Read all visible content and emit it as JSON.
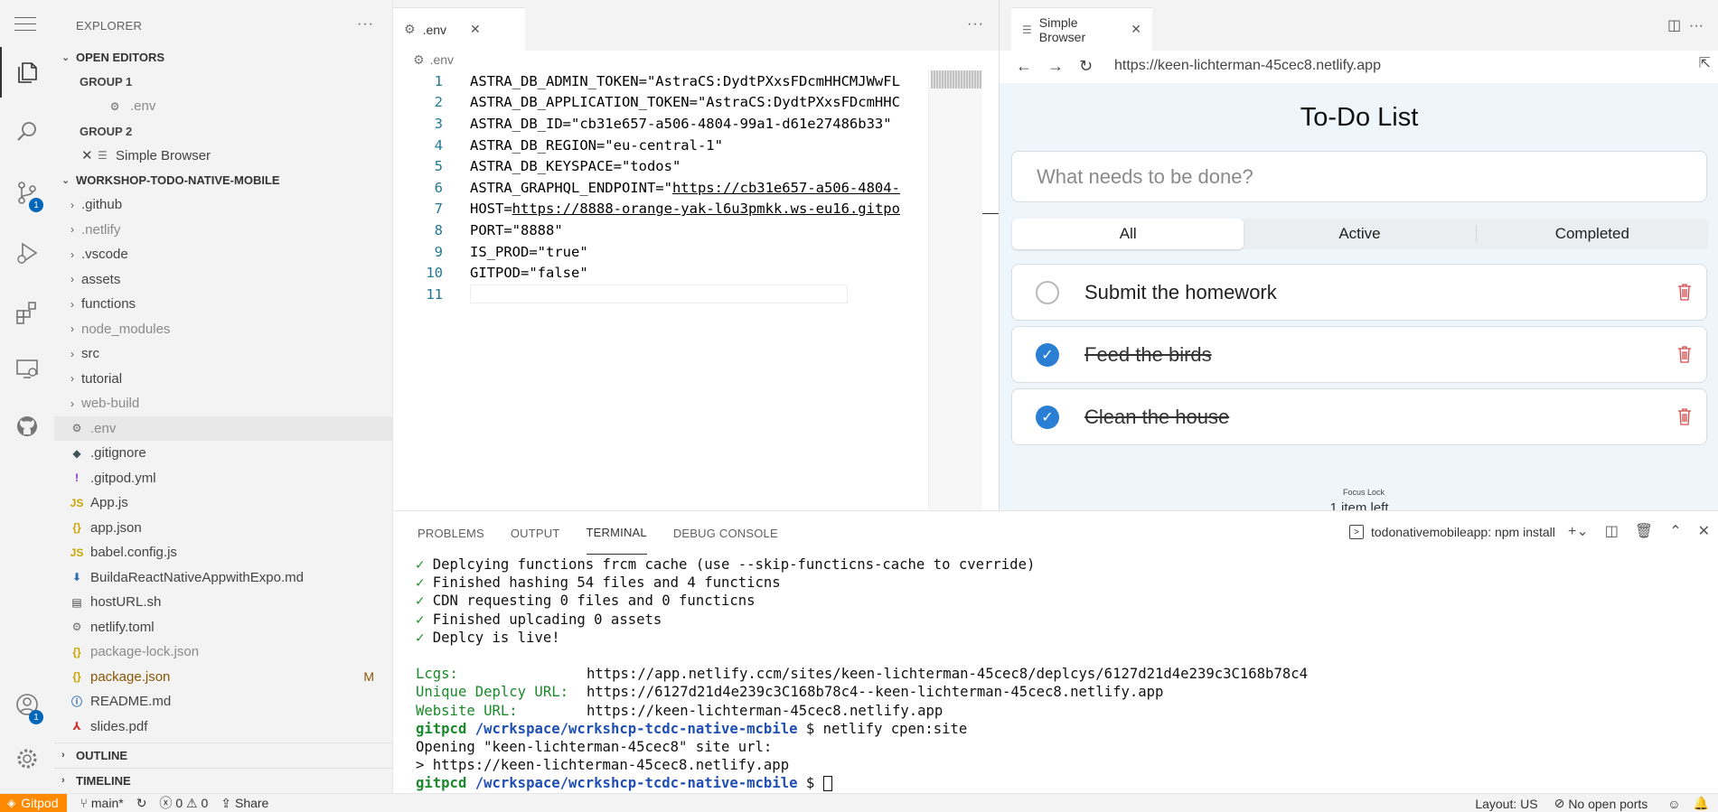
{
  "activity": {
    "scm_badge": "1",
    "account_badge": "1"
  },
  "sidebar": {
    "title": "EXPLORER",
    "more": "···",
    "open_editors": {
      "label": "OPEN EDITORS",
      "groups": [
        {
          "label": "GROUP 1",
          "file": ".env"
        },
        {
          "label": "GROUP 2",
          "file": "Simple Browser"
        }
      ]
    },
    "workspace": {
      "label": "WORKSHOP-TODO-NATIVE-MOBILE",
      "folders": [
        ".github",
        ".netlify",
        ".vscode",
        "assets",
        "functions",
        "node_modules",
        "src",
        "tutorial",
        "web-build"
      ],
      "files": [
        {
          "name": ".env",
          "icon": "gear-icon"
        },
        {
          "name": ".gitignore",
          "icon": "git-icon"
        },
        {
          "name": ".gitpod.yml",
          "icon": "exclamation-icon"
        },
        {
          "name": "App.js",
          "icon": "js-icon"
        },
        {
          "name": "app.json",
          "icon": "json-icon"
        },
        {
          "name": "babel.config.js",
          "icon": "js-icon"
        },
        {
          "name": "BuildaReactNativeAppwithExpo.md",
          "icon": "markdown-icon"
        },
        {
          "name": "hostURL.sh",
          "icon": "shell-icon"
        },
        {
          "name": "netlify.toml",
          "icon": "gear-icon"
        },
        {
          "name": "package-lock.json",
          "icon": "json-icon"
        },
        {
          "name": "package.json",
          "icon": "json-icon",
          "status": "M"
        },
        {
          "name": "README.md",
          "icon": "info-icon"
        },
        {
          "name": "slides.pdf",
          "icon": "pdf-icon"
        }
      ]
    },
    "outline": "OUTLINE",
    "timeline": "TIMELINE"
  },
  "editor": {
    "tab": ".env",
    "more": "···",
    "breadcrumb": ".env",
    "lines": [
      {
        "n": "1",
        "text": "ASTRA_DB_ADMIN_TOKEN=\"AstraCS:DydtPXxsFDcmHHCMJWwFL"
      },
      {
        "n": "2",
        "text": "ASTRA_DB_APPLICATION_TOKEN=\"AstraCS:DydtPXxsFDcmHHC"
      },
      {
        "n": "3",
        "text": "ASTRA_DB_ID=\"cb31e657-a506-4804-99a1-d61e27486b33\""
      },
      {
        "n": "4",
        "text": "ASTRA_DB_REGION=\"eu-central-1\""
      },
      {
        "n": "5",
        "text": "ASTRA_DB_KEYSPACE=\"todos\""
      },
      {
        "n": "6",
        "prefix": "ASTRA_GRAPHQL_ENDPOINT=\"",
        "link": "https://cb31e657-a506-4804-"
      },
      {
        "n": "7",
        "prefix": "HOST=",
        "link": "https://8888-orange-yak-l6u3pmkk.ws-eu16.gitpo"
      },
      {
        "n": "8",
        "text": "PORT=\"8888\""
      },
      {
        "n": "9",
        "text": "IS_PROD=\"true\""
      },
      {
        "n": "10",
        "text": "GITPOD=\"false\""
      },
      {
        "n": "11",
        "text": ""
      }
    ]
  },
  "browser": {
    "tab": "Simple Browser",
    "url": "https://keen-lichterman-45cec8.netlify.app",
    "app": {
      "title": "To-Do List",
      "placeholder": "What needs to be done?",
      "filters": [
        "All",
        "Active",
        "Completed"
      ],
      "items": [
        {
          "text": "Submit the homework",
          "done": false
        },
        {
          "text": "Feed the birds",
          "done": true
        },
        {
          "text": "Clean the house",
          "done": true
        }
      ],
      "focus_lock": "Focus Lock",
      "items_left": "1 item left"
    }
  },
  "panel": {
    "tabs": [
      "PROBLEMS",
      "OUTPUT",
      "TERMINAL",
      "DEBUG CONSOLE"
    ],
    "active_tab": "TERMINAL",
    "terminal_name": "todonativemobileapp: npm install",
    "lines": [
      "Deplcying functions frcm cache (use --skip-functicns-cache to cverride)",
      "Finished hashing 54 files and 4 functicns",
      "CDN requesting 0 files and 0 functicns",
      "Finished uplcading 0 assets",
      "Deplcy is live!"
    ],
    "logs_label": "Lcgs:",
    "logs_value": "https://app.netlify.ccm/sites/keen-lichterman-45cec8/deplcys/6127d21d4e239c3C168b78c4",
    "unique_label": "Unique Deplcy URL:",
    "unique_value": "https://6127d21d4e239c3C168b78c4--keen-lichterman-45cec8.netlify.app",
    "website_label": "Website URL:",
    "website_value": "https://keen-lichterman-45cec8.netlify.app",
    "prompt_user": "gitpcd",
    "prompt_path": "/wcrkspace/wcrkshcp-tcdc-native-mcbile",
    "prompt_cmd": " $ netlify cpen:site",
    "opening": "Opening \"keen-lichterman-45cec8\" site url:",
    "opened_url": "> https://keen-lichterman-45cec8.netlify.app",
    "prompt_end": " $ "
  },
  "status": {
    "gitpod": "Gitpod",
    "branch": "main*",
    "errors": "0",
    "warnings": "0",
    "share": "Share",
    "layout": "Layout: US",
    "ports": "No open ports"
  }
}
